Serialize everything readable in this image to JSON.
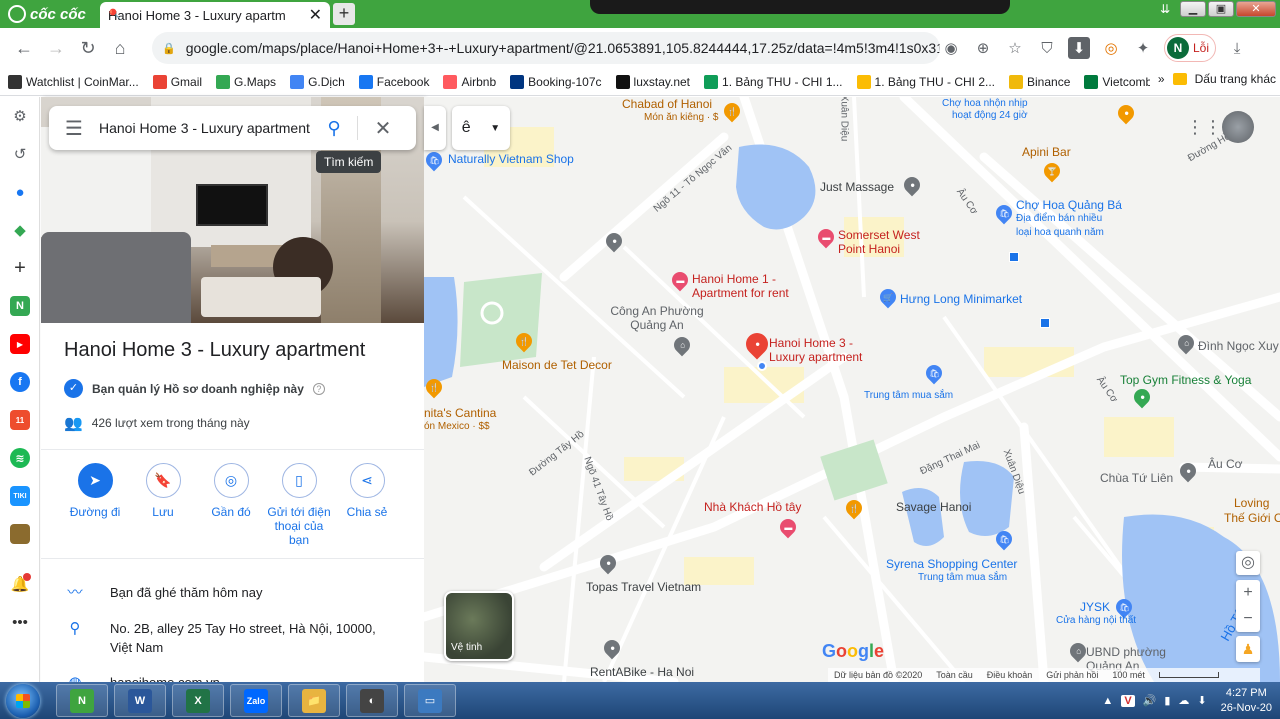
{
  "browser": {
    "brand": "cốc cốc",
    "tab_title": "Hanoi Home 3 - Luxury apartm",
    "new_tab": "+",
    "url": "google.com/maps/place/Hanoi+Home+3+-+Luxury+apartment/@21.0653891,105.8244444,17.25z/data=!4m5!3m4!1s0x3135a...",
    "profile_initial": "N",
    "profile_status": "Lỗi"
  },
  "bookmarks": [
    {
      "label": "Watchlist | CoinMar...",
      "icon": "coinmarket-icon",
      "color": "#333333"
    },
    {
      "label": "Gmail",
      "icon": "gmail-icon",
      "color": "#ea4335"
    },
    {
      "label": "G.Maps",
      "icon": "maps-icon",
      "color": "#34a853"
    },
    {
      "label": "G.Dịch",
      "icon": "translate-icon",
      "color": "#4285f4"
    },
    {
      "label": "Facebook",
      "icon": "facebook-icon",
      "color": "#1877f2"
    },
    {
      "label": "Airbnb",
      "icon": "airbnb-icon",
      "color": "#ff5a5f"
    },
    {
      "label": "Booking-107c",
      "icon": "booking-icon",
      "color": "#003580"
    },
    {
      "label": "luxstay.net",
      "icon": "luxstay-icon",
      "color": "#111111"
    },
    {
      "label": "1. Bảng THU - CHI 1...",
      "icon": "sheets-icon",
      "color": "#0f9d58"
    },
    {
      "label": "1. Bảng THU - CHI 2...",
      "icon": "drive-icon",
      "color": "#fbbc04"
    },
    {
      "label": "Binance",
      "icon": "binance-icon",
      "color": "#f0b90b"
    },
    {
      "label": "Vietcombank",
      "icon": "vietcombank-icon",
      "color": "#007a3d"
    }
  ],
  "bookmarks_more": "»",
  "bookmarks_other": "Dấu trang khác",
  "search": {
    "value": "Hanoi Home 3 - Luxury apartment",
    "tooltip": "Tìm kiếm"
  },
  "place": {
    "title": "Hanoi Home 3 - Luxury apartment",
    "verified": "Bạn quản lý Hồ sơ doanh nghiệp này",
    "views": "426 lượt xem trong tháng này",
    "actions": [
      {
        "label": "Đường đi",
        "icon": "directions-icon",
        "glyph": "➤"
      },
      {
        "label": "Lưu",
        "icon": "bookmark-icon",
        "glyph": "🔖"
      },
      {
        "label": "Gần đó",
        "icon": "nearby-icon",
        "glyph": "◎"
      },
      {
        "label": "Gửi tới điện thoại của bạn",
        "icon": "send-to-phone-icon",
        "glyph": "▯"
      },
      {
        "label": "Chia sẻ",
        "icon": "share-icon",
        "glyph": "⋖"
      }
    ],
    "visited": "Bạn đã ghé thăm hôm nay",
    "address": "No. 2B, alley 25 Tay Ho street, Hà Nội, 10000, Việt Nam",
    "website": "hanoihome.com.vn"
  },
  "map": {
    "ime": "ê",
    "labels": {
      "chabad": "Chabad of Hanoi",
      "chabad_sub": "Món ăn kiêng · $",
      "naturally": "Naturally Vietnam Shop",
      "just_massage": "Just Massage",
      "somerset": "Somerset West Point Hanoi",
      "hanoi_home1": "Hanoi Home 1 - Apartment for rent",
      "cong_an": "Công An Phường Quảng An",
      "hung_long": "Hưng Long Minimarket",
      "maison": "Maison de Tet Decor",
      "hanoi_home3": "Hanoi Home 3 - Luxury apartment",
      "cantina": "nita's Cantina",
      "cantina_sub": "ón Mexico · $$",
      "trung_tam": "Trung tâm mua sắm",
      "nha_khach": "Nhà Khách Hồ tây",
      "savage": "Savage Hanoi",
      "syrena": "Syrena Shopping Center",
      "syrena_sub": "Trung tâm mua sắm",
      "topas": "Topas Travel Vietnam",
      "rentabike": "RentABike - Ha Noi",
      "cho_hoa": "Chợ hoa nhộn nhịp",
      "cho_hoa_sub": "hoạt động 24 giờ",
      "apini": "Apini Bar",
      "cho_qba": "Chợ Hoa Quảng Bá",
      "cho_qba_sub": "Địa điểm bán nhiều loại hoa quanh năm",
      "dinh_ngoc": "Đình Ngọc Xuy",
      "top_gym": "Top Gym Fitness & Yoga",
      "chua_tu_lien": "Chùa Tứ Liên",
      "loving": "Loving",
      "the_gioi": "Thế Giới C",
      "jysk": "JYSK",
      "jysk_sub": "Cửa hàng nội thất",
      "ubnd": "UBND phường Quảng An",
      "duong_hoa": "Đường Hồ",
      "street_au_co1": "Âu Cơ",
      "street_au_co2": "Âu Cơ",
      "street_au_co3": "Âu Cơ",
      "street_ngo11": "Ngõ 11 - Tô Ngọc Vân",
      "street_tay_ho": "Đường Tây Hồ",
      "street_ngo41": "Ngõ 41 Tây Hồ",
      "street_dang_thai_mai": "Đặng Thai Mai",
      "street_xuan_dieu": "Xuân Diệu",
      "street_xuan_dieu2": "Xuân Diệu",
      "lake": "Hồ Tây"
    },
    "satellite": "Vệ tinh",
    "google": "Google",
    "attribution": {
      "data": "Dữ liệu bản đồ ©2020",
      "terms": "Toàn cầu",
      "privacy": "Điều khoản",
      "feedback": "Gửi phản hồi",
      "scale": "100 mét"
    }
  },
  "taskbar": {
    "time": "4:27 PM",
    "date": "26-Nov-20",
    "apps": [
      {
        "name": "coccoc",
        "label": "N",
        "color": "#3fa43f"
      },
      {
        "name": "word",
        "label": "W",
        "color": "#2b579a"
      },
      {
        "name": "excel",
        "label": "X",
        "color": "#217346"
      },
      {
        "name": "zalo",
        "label": "Zalo",
        "color": "#0068ff"
      },
      {
        "name": "explorer",
        "label": "📁",
        "color": "#e8b440"
      },
      {
        "name": "recorder",
        "label": "◐",
        "color": "#444444"
      },
      {
        "name": "display",
        "label": "▭",
        "color": "#3c7ac0"
      }
    ]
  }
}
